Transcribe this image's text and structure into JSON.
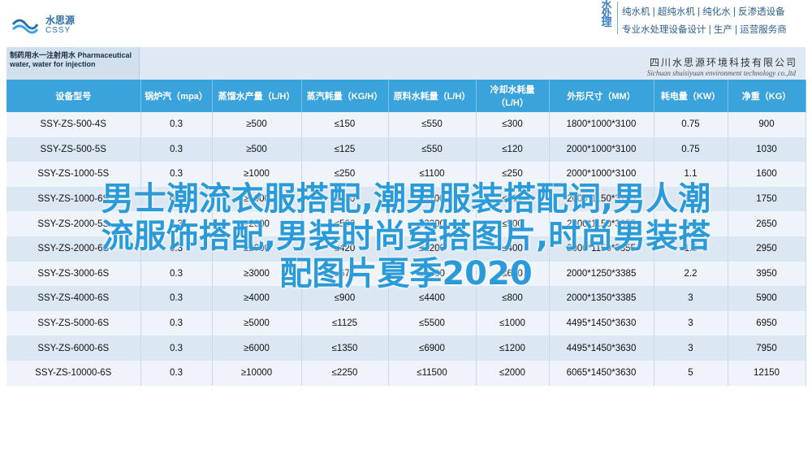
{
  "brand": {
    "name_cn": "水思源",
    "name_en": "CSSY",
    "tagline_vertical": "水处理",
    "tagline_line1": "纯水机 | 超纯水机 | 纯化水 | 反渗透设备",
    "tagline_line2": "专业水处理设备设计 | 生产 | 运营服务商",
    "accent_color": "#3aa3dc"
  },
  "document": {
    "title": "制药用水一注射用水 Pharmaceutical water, water for injection",
    "company_cn": "四川水思源环境科技有限公司",
    "company_en": "Sichuan shuisiyuan environment technology co.,ltd"
  },
  "table": {
    "headers": [
      "设备型号",
      "锅炉汽（mpa）",
      "蒸馏水产量（L/H）",
      "蒸汽耗量（KG/H）",
      "原料水耗量（L/H）",
      "冷却水耗量（L/H）",
      "外形尺寸（MM）",
      "耗电量（KW）",
      "净重（KG）"
    ],
    "rows": [
      [
        "SSY-ZS-500-4S",
        "0.3",
        "≥500",
        "≤150",
        "≤550",
        "≤300",
        "1800*1000*3100",
        "0.75",
        "900"
      ],
      [
        "SSY-ZS-500-5S",
        "0.3",
        "≥500",
        "≤125",
        "≤550",
        "≤120",
        "2000*1000*3100",
        "0.75",
        "1030"
      ],
      [
        "SSY-ZS-1000-5S",
        "0.3",
        "≥1000",
        "≤250",
        "≤1100",
        "≤250",
        "2000*1000*3100",
        "1.1",
        "1600"
      ],
      [
        "SSY-ZS-1000-6S",
        "0.3",
        "≥1000",
        "≤210",
        "≤1100",
        "≤200",
        "2000*1150*3100",
        "1.1",
        "1750"
      ],
      [
        "SSY-ZS-2000-5S",
        "0.3",
        "≥2000",
        "≤500",
        "≤2200",
        "≤500",
        "2000*1150*3355",
        "1.5",
        "2650"
      ],
      [
        "SSY-ZS-2000-6S",
        "0.3",
        "≥2000",
        "≤420",
        "≤2200",
        "≤400",
        "2000*1150*3355",
        "1.5",
        "2950"
      ],
      [
        "SSY-ZS-3000-6S",
        "0.3",
        "≥3000",
        "≤675",
        "≤3300",
        "≤600",
        "2000*1250*3385",
        "2.2",
        "3950"
      ],
      [
        "SSY-ZS-4000-6S",
        "0.3",
        "≥4000",
        "≤900",
        "≤4400",
        "≤800",
        "2000*1350*3385",
        "3",
        "5900"
      ],
      [
        "SSY-ZS-5000-6S",
        "0.3",
        "≥5000",
        "≤1125",
        "≤5500",
        "≤1000",
        "4495*1450*3630",
        "3",
        "6950"
      ],
      [
        "SSY-ZS-6000-6S",
        "0.3",
        "≥6000",
        "≤1350",
        "≤6900",
        "≤1200",
        "4495*1450*3630",
        "3",
        "7950"
      ],
      [
        "SSY-ZS-10000-6S",
        "0.3",
        "≥10000",
        "≤2250",
        "≤11500",
        "≤2000",
        "6065*1450*3630",
        "5",
        "12150"
      ]
    ]
  },
  "overlay": {
    "line1": "男士潮流衣服搭配,潮男服装搭配词,男人潮",
    "line2": "流服饰搭配,男装时尚穿搭图片,时尚男装搭",
    "line3": "配图片夏季2020"
  }
}
